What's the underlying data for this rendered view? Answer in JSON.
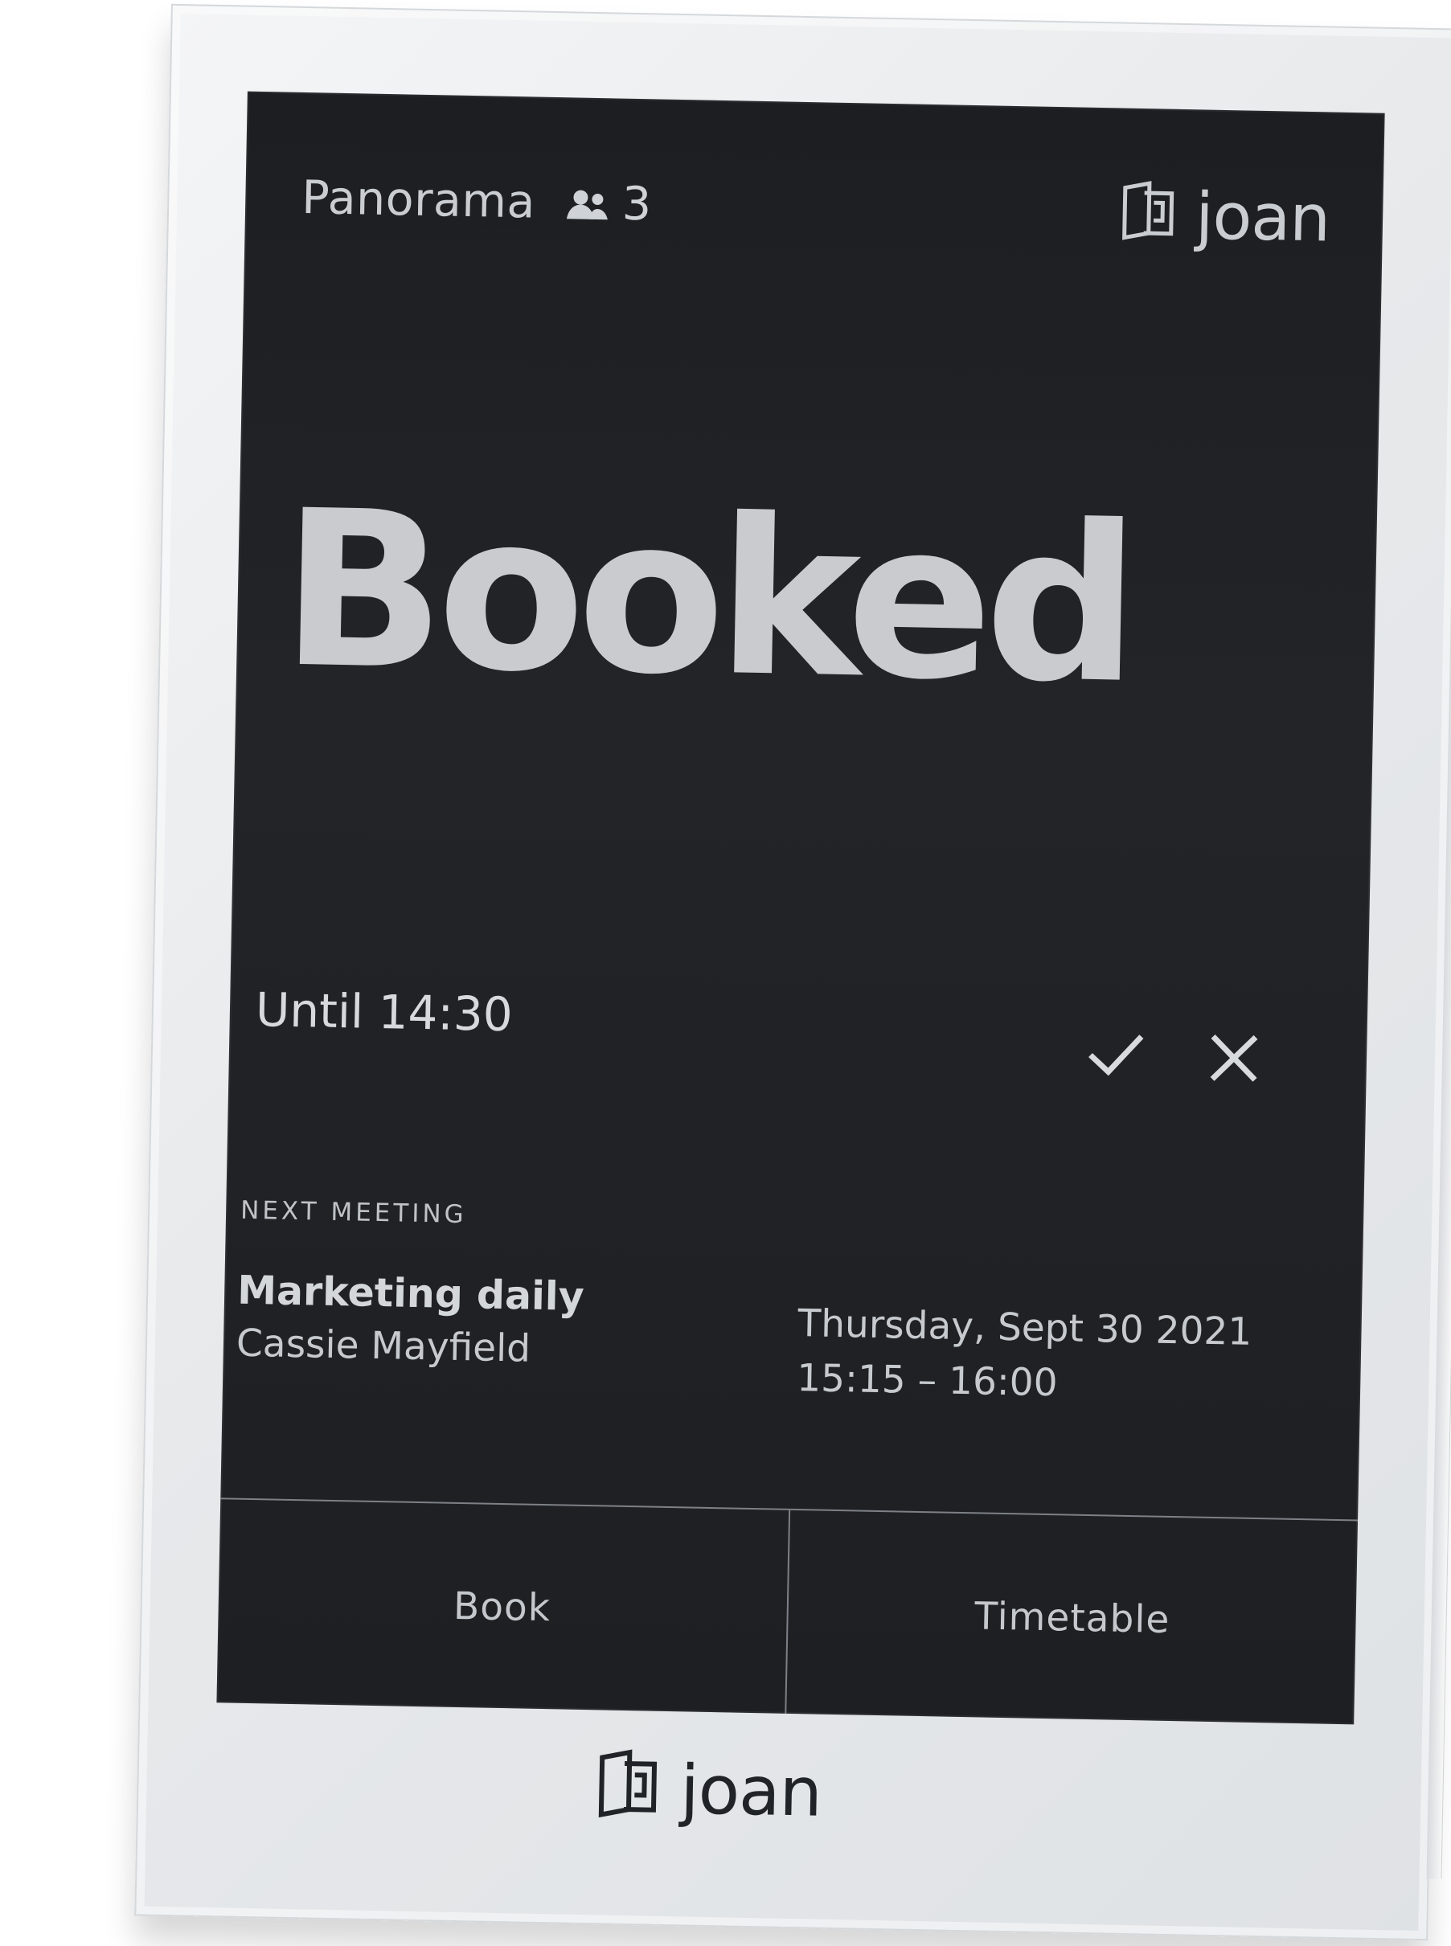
{
  "device": {
    "room_name": "Panorama",
    "capacity": "3",
    "brand_top": "joan",
    "brand_bottom": "joan"
  },
  "status": {
    "title": "Booked",
    "until": "Until 14:30"
  },
  "actions": {
    "confirm_icon": "check-icon",
    "cancel_icon": "close-icon"
  },
  "next_meeting": {
    "label": "NEXT MEETING",
    "title": "Marketing daily",
    "host": "Cassie Mayfield",
    "date": "Thursday, Sept 30 2021",
    "time": "15:15 – 16:00"
  },
  "bottom_bar": {
    "book_label": "Book",
    "timetable_label": "Timetable"
  },
  "colors": {
    "screen_bg": "#1f2124",
    "screen_text": "#d5d8dc",
    "frame_bg": "#eceef0",
    "logo_dark": "#202327"
  }
}
